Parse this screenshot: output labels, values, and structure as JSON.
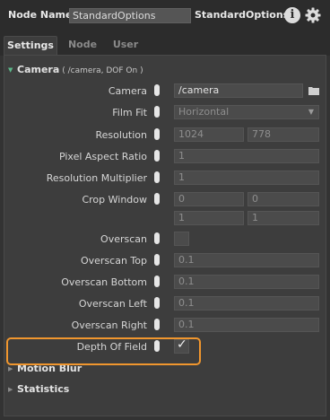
{
  "header": {
    "node_name_label": "Node Name",
    "node_name_value": "StandardOptions",
    "node_type": "StandardOptions",
    "info_icon": "i"
  },
  "tabs": [
    {
      "label": "Settings",
      "active": true
    },
    {
      "label": "Node",
      "active": false
    },
    {
      "label": "User",
      "active": false
    }
  ],
  "camera_section": {
    "title": "Camera",
    "summary": "( /camera, DOF On )",
    "expanded": true,
    "camera": {
      "label": "Camera",
      "value": "/camera"
    },
    "film_fit": {
      "label": "Film Fit",
      "value": "Horizontal"
    },
    "resolution": {
      "label": "Resolution",
      "x": "1024",
      "y": "778"
    },
    "pixel_aspect_ratio": {
      "label": "Pixel Aspect Ratio",
      "value": "1"
    },
    "resolution_multiplier": {
      "label": "Resolution Multiplier",
      "value": "1"
    },
    "crop_window": {
      "label": "Crop Window",
      "min_x": "0",
      "min_y": "0",
      "max_x": "1",
      "max_y": "1"
    },
    "overscan": {
      "label": "Overscan",
      "checked": false
    },
    "overscan_top": {
      "label": "Overscan Top",
      "value": "0.1"
    },
    "overscan_bottom": {
      "label": "Overscan Bottom",
      "value": "0.1"
    },
    "overscan_left": {
      "label": "Overscan Left",
      "value": "0.1"
    },
    "overscan_right": {
      "label": "Overscan Right",
      "value": "0.1"
    },
    "depth_of_field": {
      "label": "Depth Of Field",
      "checked": true,
      "check_glyph": "✓"
    }
  },
  "motion_blur_section": {
    "title": "Motion Blur",
    "expanded": false
  },
  "statistics_section": {
    "title": "Statistics",
    "expanded": false
  },
  "colors": {
    "background": "#333333",
    "panel": "#3d3d3d",
    "field": "#4b4b4b",
    "expanded_triangle": "#5cb88a",
    "highlight": "#f0962e"
  },
  "icons": {
    "info": "info-icon",
    "settings": "gear-icon",
    "browse": "folder-icon",
    "expanded": "triangle-down-icon",
    "collapsed": "triangle-right-icon",
    "dropdown": "chevron-down-icon"
  }
}
